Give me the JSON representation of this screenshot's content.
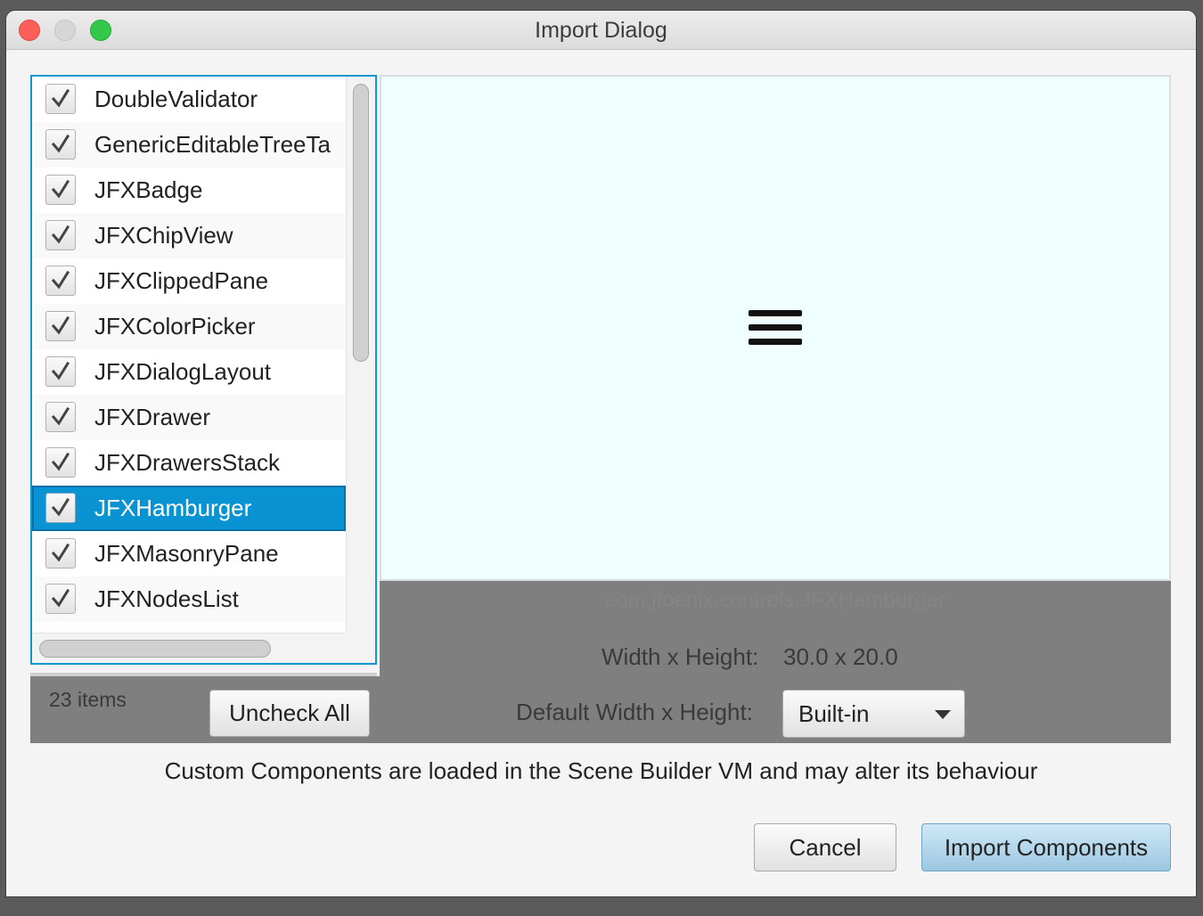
{
  "window": {
    "title": "Import Dialog"
  },
  "components": {
    "items": [
      {
        "label": "DoubleValidator",
        "checked": true
      },
      {
        "label": "GenericEditableTreeTa",
        "checked": true
      },
      {
        "label": "JFXBadge",
        "checked": true
      },
      {
        "label": "JFXChipView",
        "checked": true
      },
      {
        "label": "JFXClippedPane",
        "checked": true
      },
      {
        "label": "JFXColorPicker",
        "checked": true
      },
      {
        "label": "JFXDialogLayout",
        "checked": true
      },
      {
        "label": "JFXDrawer",
        "checked": true
      },
      {
        "label": "JFXDrawersStack",
        "checked": true
      },
      {
        "label": "JFXHamburger",
        "checked": true,
        "selected": true
      },
      {
        "label": "JFXMasonryPane",
        "checked": true
      },
      {
        "label": "JFXNodesList",
        "checked": true
      }
    ],
    "count_label": "23 items",
    "uncheck_all_label": "Uncheck All"
  },
  "preview": {
    "class_name": "com.jfoenix.controls.JFXHamburger",
    "icon": "hamburger-icon",
    "size_label": "Width x Height:",
    "size_value": "30.0 x 20.0",
    "default_size_label": "Default Width x Height:",
    "default_size_value": "Built-in"
  },
  "warning": "Custom Components are loaded in the Scene Builder VM and may alter its behaviour",
  "buttons": {
    "cancel": "Cancel",
    "import": "Import Components"
  },
  "colors": {
    "selection": "#0993d3",
    "preview_bg": "#effffd",
    "accent": "#0f96d3"
  }
}
